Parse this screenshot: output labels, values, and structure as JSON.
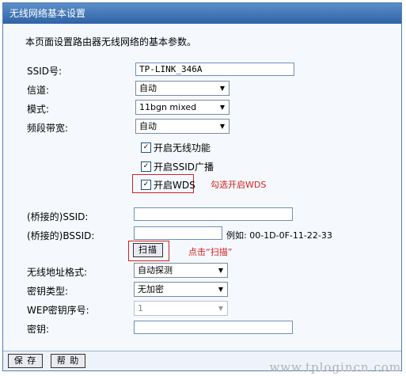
{
  "title": "无线网络基本设置",
  "intro": "本页面设置路由器无线网络的基本参数。",
  "ssid": {
    "label": "SSID号:",
    "value": "TP-LINK_346A"
  },
  "channel": {
    "label": "信道:",
    "value": "自动"
  },
  "mode": {
    "label": "模式:",
    "value": "11bgn mixed"
  },
  "bandwidth": {
    "label": "频段带宽:",
    "value": "自动"
  },
  "checks": {
    "wireless": {
      "label": "开启无线功能",
      "checked": true
    },
    "broadcast": {
      "label": "开启SSID广播",
      "checked": true
    },
    "wds": {
      "label": "开启WDS",
      "checked": true
    }
  },
  "annotations": {
    "wds": "勾选开启WDS",
    "scan": "点击“扫描”"
  },
  "bridge_ssid": {
    "label": "(桥接的)SSID:",
    "value": ""
  },
  "bridge_bssid": {
    "label": "(桥接的)BSSID:",
    "value": "",
    "example": "例如: 00-1D-0F-11-22-33"
  },
  "scan_button": "扫描",
  "address_format": {
    "label": "无线地址格式:",
    "value": "自动探测"
  },
  "key_type": {
    "label": "密钥类型:",
    "value": "无加密"
  },
  "wep_index": {
    "label": "WEP密钥序号:",
    "value": "1"
  },
  "key": {
    "label": "密钥:",
    "value": ""
  },
  "footer": {
    "save": "保 存",
    "help": "帮 助"
  },
  "watermark": "www.tplogincn.com",
  "colors": {
    "title_bar": "#3a6fb0",
    "annotation": "#d42020",
    "panel_bg": "#f5f9fd"
  }
}
